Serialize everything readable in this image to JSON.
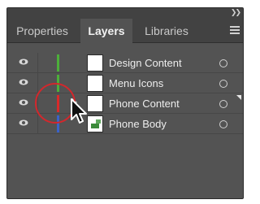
{
  "panel": {
    "tabs": [
      {
        "label": "Properties",
        "active": false
      },
      {
        "label": "Layers",
        "active": true
      },
      {
        "label": "Libraries",
        "active": false
      }
    ],
    "collapse_icon": "double-chevron-right-icon",
    "menu_icon": "hamburger-menu-icon"
  },
  "layers": [
    {
      "name": "Design Content",
      "color": "#4caf3a",
      "visible": true
    },
    {
      "name": "Menu Icons",
      "color": "#4caf3a",
      "visible": true
    },
    {
      "name": "Phone Content",
      "color": "#d92a2a",
      "visible": true
    },
    {
      "name": "Phone Body",
      "color": "#3a62c9",
      "visible": true
    }
  ],
  "colors": {
    "panel_bg": "#535353",
    "tabbar_bg": "#424242",
    "highlight": "#d3272c"
  }
}
